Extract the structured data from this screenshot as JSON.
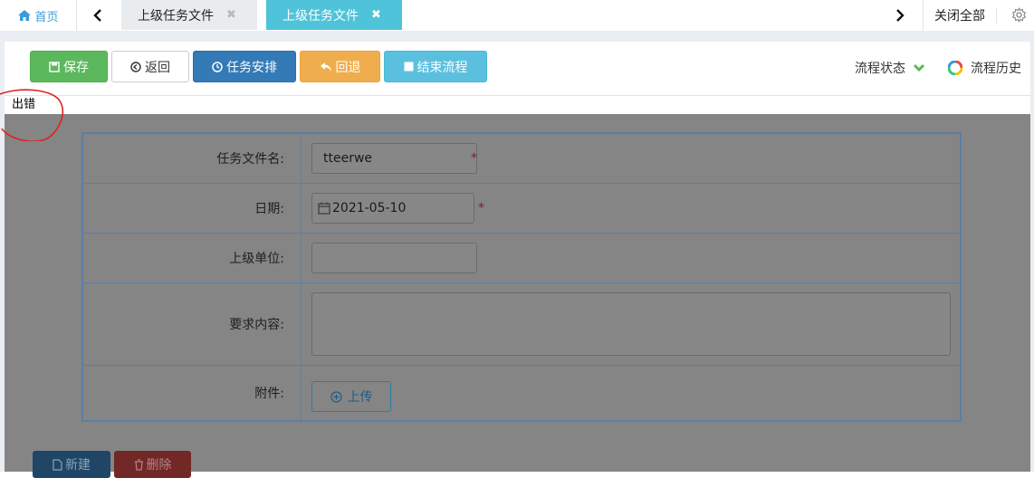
{
  "tabs": {
    "home_label": "首页",
    "tab1_label": "上级任务文件",
    "tab2_label": "上级任务文件",
    "close_all": "关闭全部"
  },
  "toolbar": {
    "save": "保存",
    "back": "返回",
    "task_arrange": "任务安排",
    "rollback": "回退",
    "end_flow": "结束流程",
    "flow_status": "流程状态",
    "flow_history": "流程历史"
  },
  "error_text": "出错",
  "form": {
    "task_file_name_label": "任务文件名:",
    "task_file_name_value": "tteerwe",
    "date_label": "日期:",
    "date_value": "2021-05-10",
    "parent_unit_label": "上级单位:",
    "parent_unit_value": "",
    "requirement_label": "要求内容:",
    "requirement_value": "",
    "attachment_label": "附件:",
    "upload_label": "上传",
    "required_mark": "*"
  },
  "bottom": {
    "new_label": "新建",
    "delete_label": "删除"
  },
  "colors": {
    "save": "#5cb85c",
    "task_arrange": "#337ab7",
    "rollback": "#f0ad4e",
    "end_flow": "#5bc0de",
    "active_tab": "#4fc3d9",
    "annotation": "#e02020"
  },
  "icons": [
    "home-icon",
    "chevron-left-icon",
    "chevron-right-icon",
    "close-icon",
    "gear-icon",
    "floppy-icon",
    "back-circle-icon",
    "clock-icon",
    "reply-icon",
    "stop-icon",
    "chevron-down-icon",
    "ring-icon",
    "calendar-icon",
    "plus-circle-icon",
    "file-icon",
    "trash-icon"
  ]
}
